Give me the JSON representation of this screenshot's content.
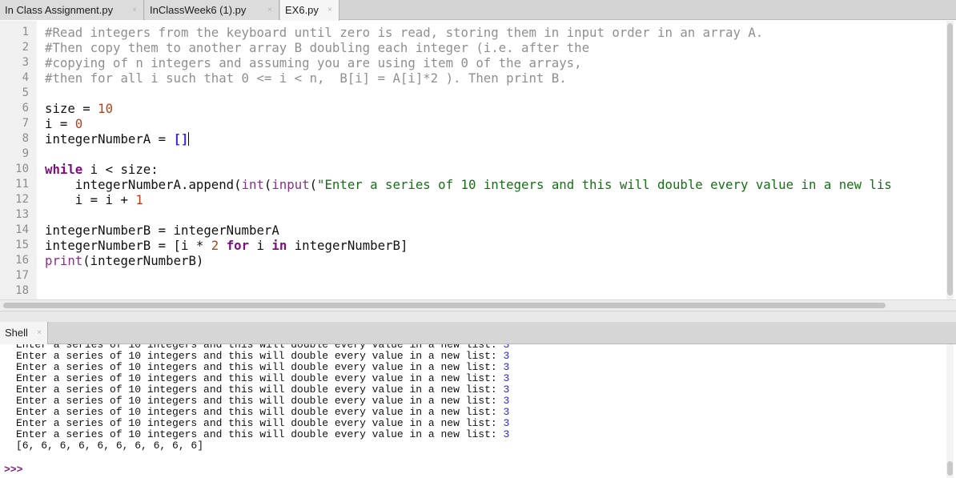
{
  "tabs": [
    {
      "label": "In Class Assignment.py",
      "close": "×",
      "active": false
    },
    {
      "label": "InClassWeek6 (1).py",
      "close": "×",
      "active": false
    },
    {
      "label": "EX6.py",
      "close": "×",
      "active": true
    }
  ],
  "editor": {
    "line_numbers": [
      "1",
      "2",
      "3",
      "4",
      "5",
      "6",
      "7",
      "8",
      "9",
      "10",
      "11",
      "12",
      "13",
      "14",
      "15",
      "16",
      "17",
      "18"
    ],
    "lines": {
      "l1": "#Read integers from the keyboard until zero is read, storing them in input order in an array A.",
      "l2": "#Then copy them to another array B doubling each integer (i.e. after the",
      "l3": "#copying of n integers and assuming you are using item 0 of the arrays,",
      "l4": "#then for all i such that 0 <= i < n,  B[i] = A[i]*2 ). Then print B.",
      "l6_var": "size = ",
      "l6_num": "10",
      "l7_var": "i = ",
      "l7_num": "0",
      "l8_var": "integerNumberA = ",
      "l8_br": "[]",
      "l10_kw": "while",
      "l10_rest": " i < size:",
      "l11_a": "    integerNumberA.append(",
      "l11_int": "int",
      "l11_b": "(",
      "l11_input": "input",
      "l11_c": "(",
      "l11_str": "\"Enter a series of 10 integers and this will double every value in a new lis",
      "l12_a": "    i = i + ",
      "l12_num": "1",
      "l14": "integerNumberB = integerNumberA",
      "l15_a": "integerNumberB = [i * ",
      "l15_num": "2",
      "l15_kw1": "for",
      "l15_b": " i ",
      "l15_kw2": "in",
      "l15_c": " integerNumberB]",
      "l16_fn": "print",
      "l16_rest": "(integerNumberB)"
    }
  },
  "shell": {
    "tab_label": "Shell",
    "tab_close": "×",
    "prompt_text": "Enter a series of 10 integers and this will double every value in a new list: ",
    "input_value": "3",
    "output": "[6, 6, 6, 6, 6, 6, 6, 6, 6, 6]",
    "prompt": ">>>"
  },
  "colors": {
    "comment": "#8f8f8f",
    "keyword": "#7f0d7f",
    "number": "#b4401a",
    "string": "#157015",
    "bracket": "#3b2bd6",
    "shell_input": "#2a2acf"
  }
}
